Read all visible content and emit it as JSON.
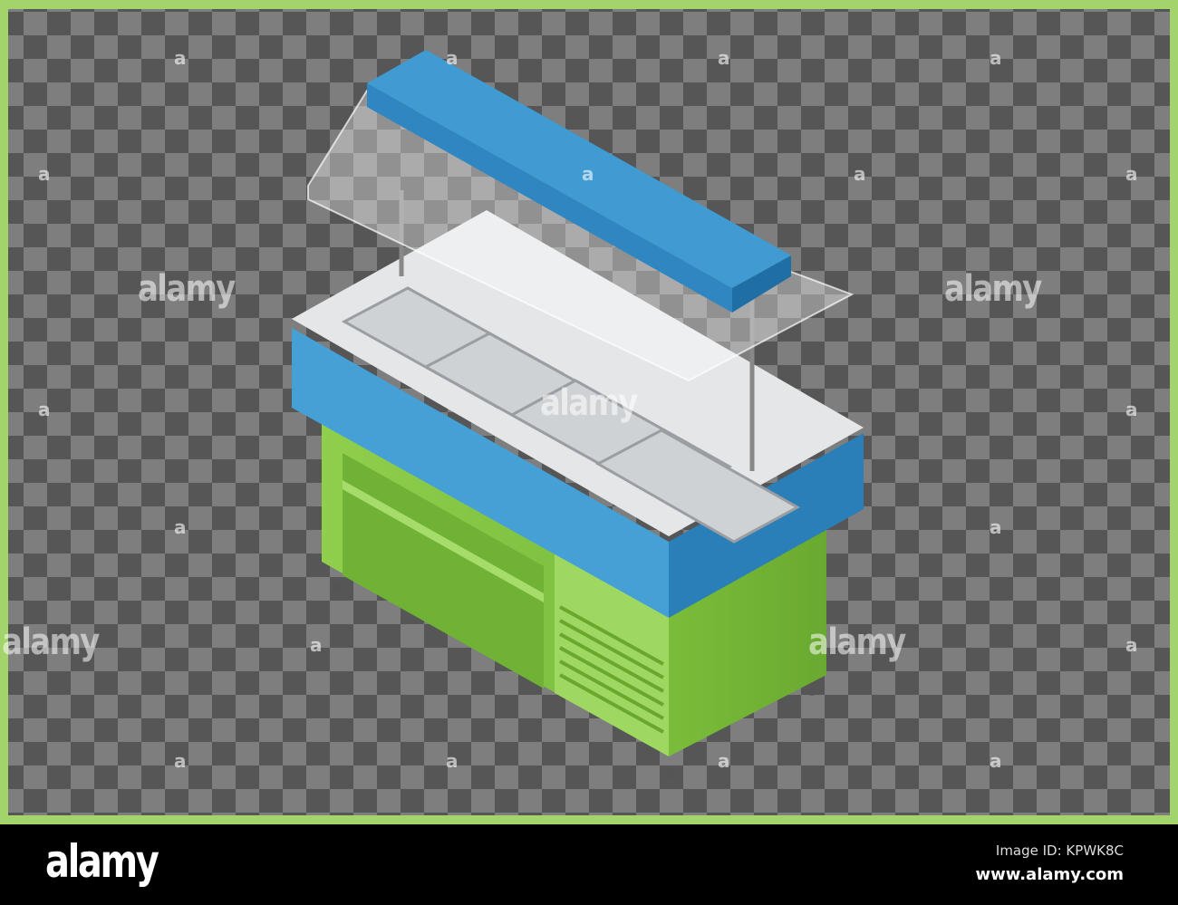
{
  "watermark": {
    "text": "alamy",
    "glyph": "a"
  },
  "footer": {
    "logo": "alamy",
    "image_id": "Image ID: KPWK8C",
    "url": "www.alamy.com"
  },
  "colors": {
    "border": "#a3d36b",
    "blue": "#3f9bd1",
    "green": "#7cc242",
    "counter": "#e4e6e8"
  }
}
